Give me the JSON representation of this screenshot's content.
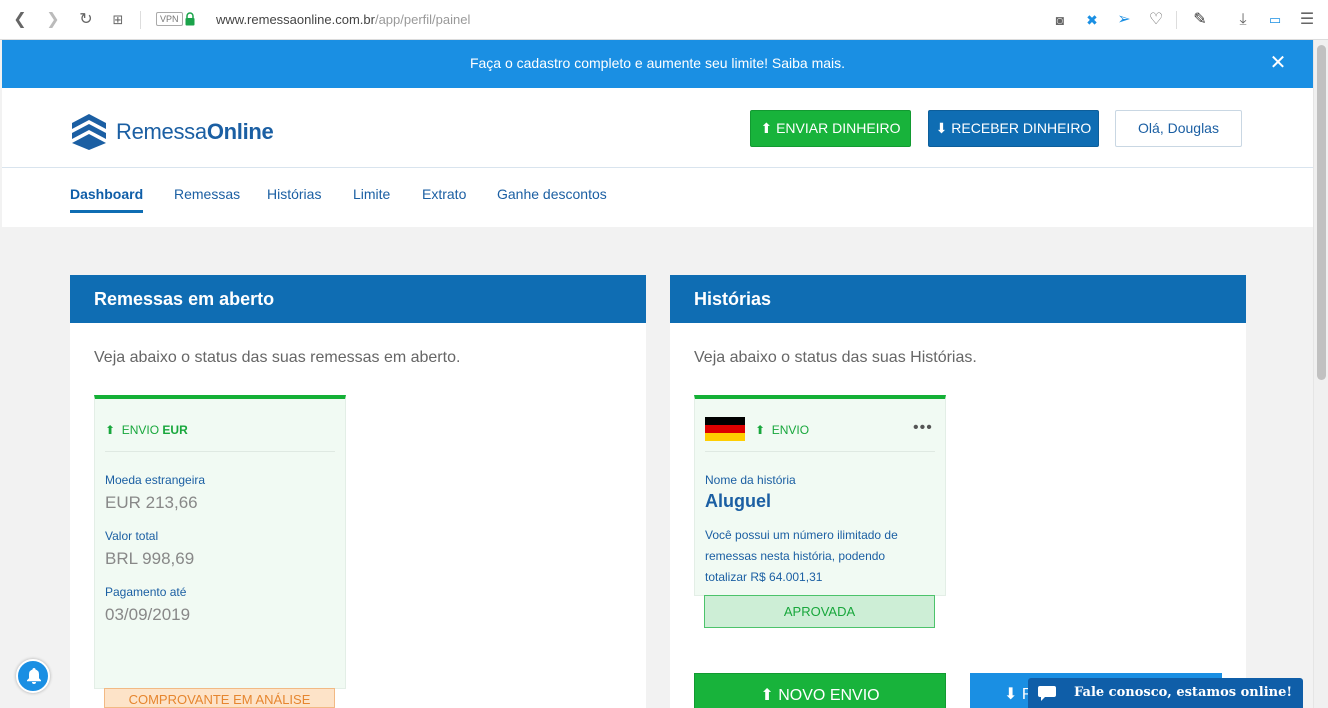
{
  "browser": {
    "vpn_label": "VPN",
    "url_host": "www.remessaonline.com.br",
    "url_path": "/app/perfil/painel"
  },
  "banner": {
    "text": "Faça o cadastro completo e aumente seu limite! Saiba mais.",
    "close_label": "✕"
  },
  "header": {
    "brand_light": "Remessa",
    "brand_bold": "Online",
    "send_button": "ENVIAR DINHEIRO",
    "receive_button": "RECEBER DINHEIRO",
    "user_button": "Olá, Douglas"
  },
  "tabs": [
    {
      "label": "Dashboard",
      "active": true
    },
    {
      "label": "Remessas"
    },
    {
      "label": "Histórias"
    },
    {
      "label": "Limite"
    },
    {
      "label": "Extrato"
    },
    {
      "label": "Ganhe descontos"
    }
  ],
  "open_remittances": {
    "title": "Remessas em aberto",
    "description": "Veja abaixo o status das suas remessas em aberto.",
    "card": {
      "type_label": "ENVIO",
      "currency": "EUR",
      "foreign_label": "Moeda estrangeira",
      "foreign_value": "EUR 213,66",
      "total_label": "Valor total",
      "total_value": "BRL 998,69",
      "due_label": "Pagamento até",
      "due_value": "03/09/2019",
      "status": "COMPROVANTE EM ANÁLISE"
    }
  },
  "stories": {
    "title": "Histórias",
    "description": "Veja abaixo o status das suas Histórias.",
    "card": {
      "type_label": "ENVIO",
      "name_label": "Nome da história",
      "name": "Aluguel",
      "info": "Você possui um número ilimitado de remessas nesta história, podendo totalizar R$ 64.001,31",
      "status": "APROVADA"
    },
    "new_button": "NOVO ENVIO",
    "receive_button": "R"
  },
  "chat": {
    "text": "Fale conosco, estamos online!"
  },
  "colors": {
    "primary_blue": "#0f6db3",
    "banner_blue": "#1a8fe3",
    "green": "#18b33b",
    "approved_bg": "#cdeed6",
    "analysis_bg": "#fde3c8"
  }
}
